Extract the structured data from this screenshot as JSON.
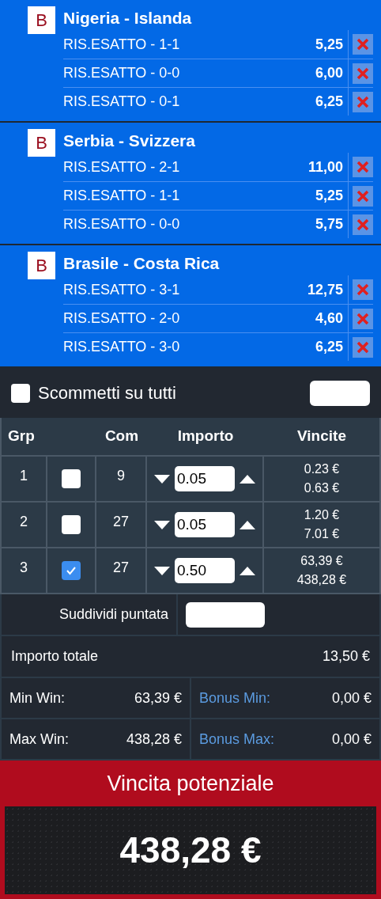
{
  "matches": [
    {
      "badge": "B",
      "title": "Nigeria - Islanda",
      "selections": [
        {
          "label": "RIS.ESATTO - 1-1",
          "odds": "5,25"
        },
        {
          "label": "RIS.ESATTO - 0-0",
          "odds": "6,00"
        },
        {
          "label": "RIS.ESATTO - 0-1",
          "odds": "6,25"
        }
      ]
    },
    {
      "badge": "B",
      "title": "Serbia - Svizzera",
      "selections": [
        {
          "label": "RIS.ESATTO - 2-1",
          "odds": "11,00"
        },
        {
          "label": "RIS.ESATTO - 1-1",
          "odds": "5,25"
        },
        {
          "label": "RIS.ESATTO - 0-0",
          "odds": "5,75"
        }
      ]
    },
    {
      "badge": "B",
      "title": "Brasile - Costa Rica",
      "selections": [
        {
          "label": "RIS.ESATTO - 3-1",
          "odds": "12,75"
        },
        {
          "label": "RIS.ESATTO - 2-0",
          "odds": "4,60"
        },
        {
          "label": "RIS.ESATTO - 3-0",
          "odds": "6,25"
        }
      ]
    }
  ],
  "bet_all": {
    "label": "Scommetti su tutti",
    "checked": false
  },
  "table": {
    "columns": [
      "Grp",
      "Com",
      "Importo",
      "Vincite"
    ],
    "rows": [
      {
        "group": "1",
        "checked": false,
        "combos": "9",
        "amount": "0.05",
        "wins": [
          "0.23 €",
          "0.63 €"
        ]
      },
      {
        "group": "2",
        "checked": false,
        "combos": "27",
        "amount": "0.05",
        "wins": [
          "1.20 €",
          "7.01 €"
        ]
      },
      {
        "group": "3",
        "checked": true,
        "combos": "27",
        "amount": "0.50",
        "wins": [
          "63,39 €",
          "438,28 €"
        ]
      }
    ]
  },
  "split": {
    "label": "Suddividi puntata"
  },
  "total": {
    "label": "Importo totale",
    "value": "13,50 €"
  },
  "summary": [
    {
      "label": "Min Win:",
      "value": "63,39 €",
      "bonus_label": "Bonus Min:",
      "bonus_value": "0,00 €"
    },
    {
      "label": "Max Win:",
      "value": "438,28 €",
      "bonus_label": "Bonus Max:",
      "bonus_value": "0,00 €"
    }
  ],
  "potential": {
    "title": "Vincita potenziale",
    "value": "438,28 €"
  }
}
